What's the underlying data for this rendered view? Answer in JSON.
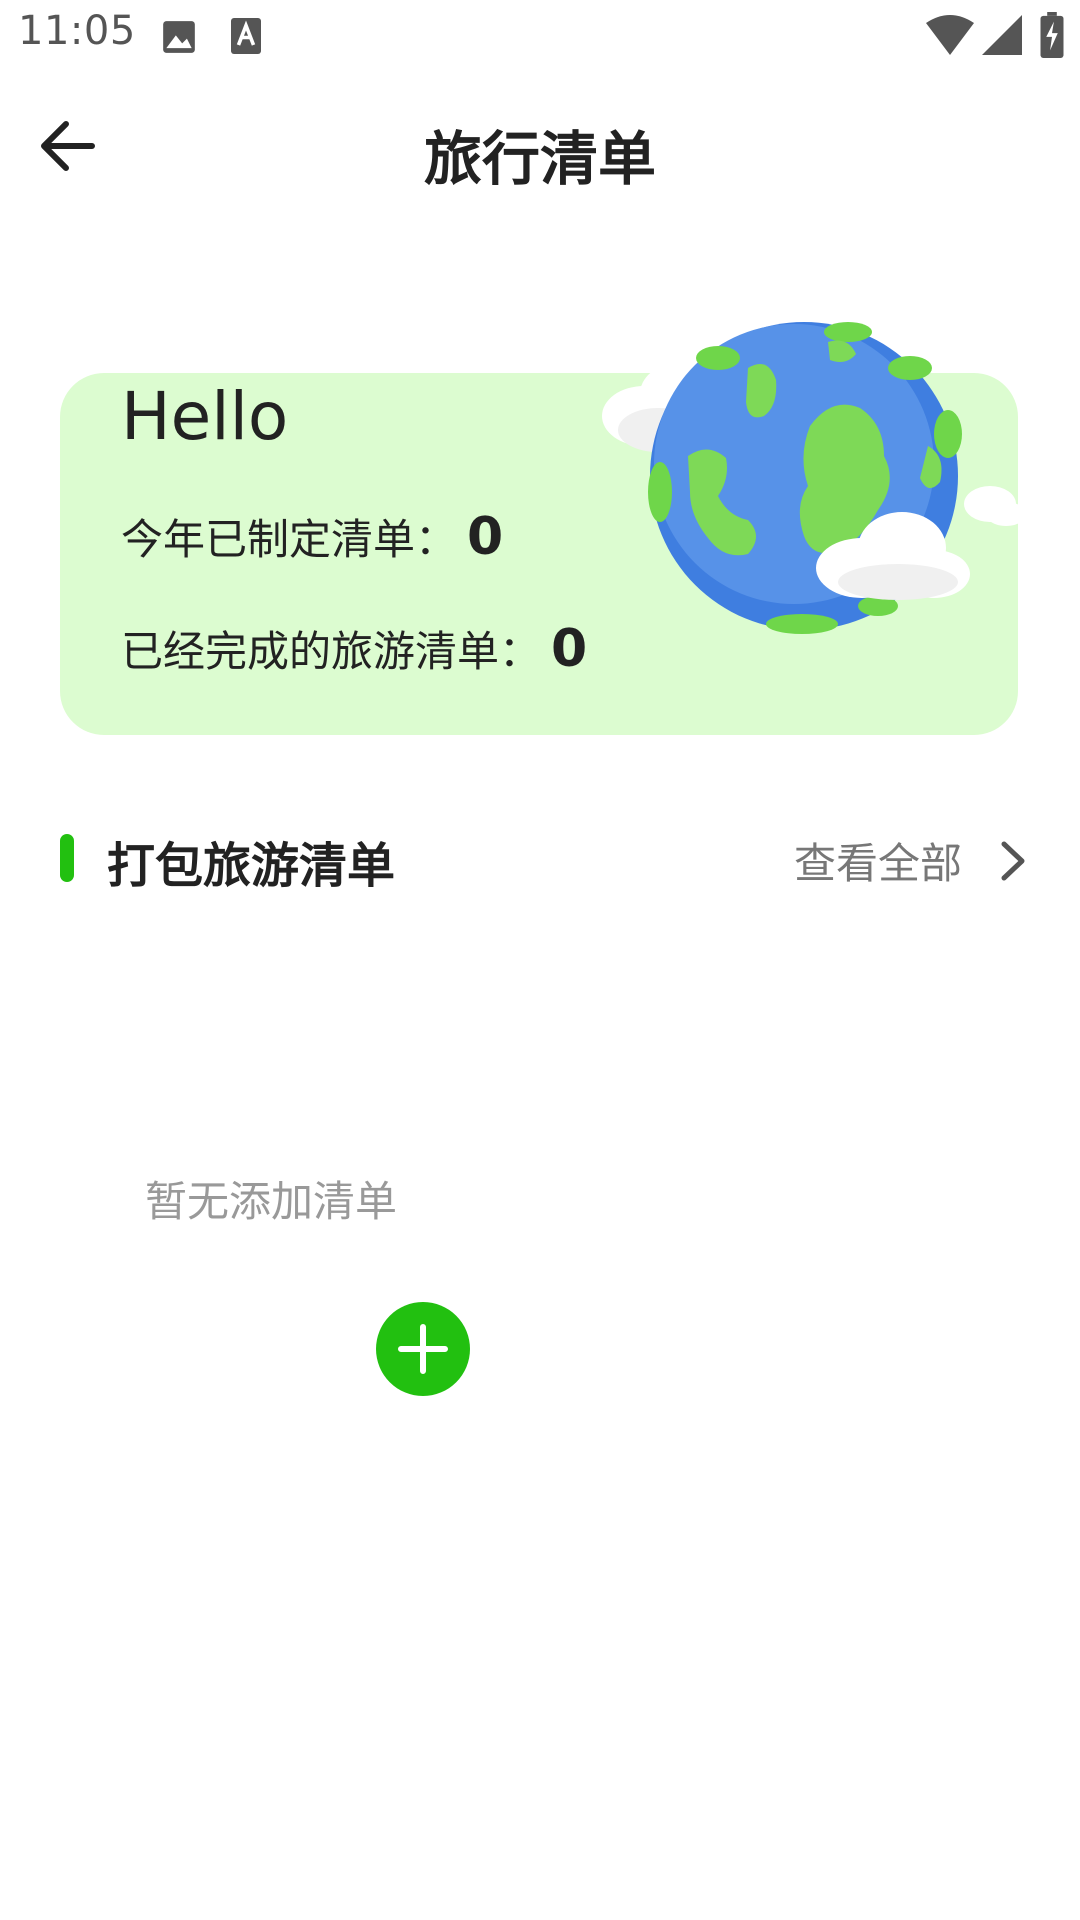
{
  "status_bar": {
    "time": "11:05",
    "icons": [
      "image-icon",
      "a-icon",
      "wifi-icon",
      "signal-icon",
      "battery-icon"
    ]
  },
  "app_bar": {
    "title": "旅行清单",
    "back_icon": "back-arrow-icon"
  },
  "hero": {
    "greeting": "Hello",
    "stats": [
      {
        "label": "今年已制定清单：",
        "value": "0"
      },
      {
        "label": "已经完成的旅游清单：",
        "value": "0"
      }
    ],
    "image": "globe-illustration"
  },
  "section": {
    "title": "打包旅游清单",
    "view_all": "查看全部",
    "accent_color": "#22c010"
  },
  "empty_state": {
    "message": "暂无添加清单",
    "add_icon": "plus-icon"
  },
  "colors": {
    "card_bg": "#dcfcd0",
    "accent": "#22c010"
  }
}
